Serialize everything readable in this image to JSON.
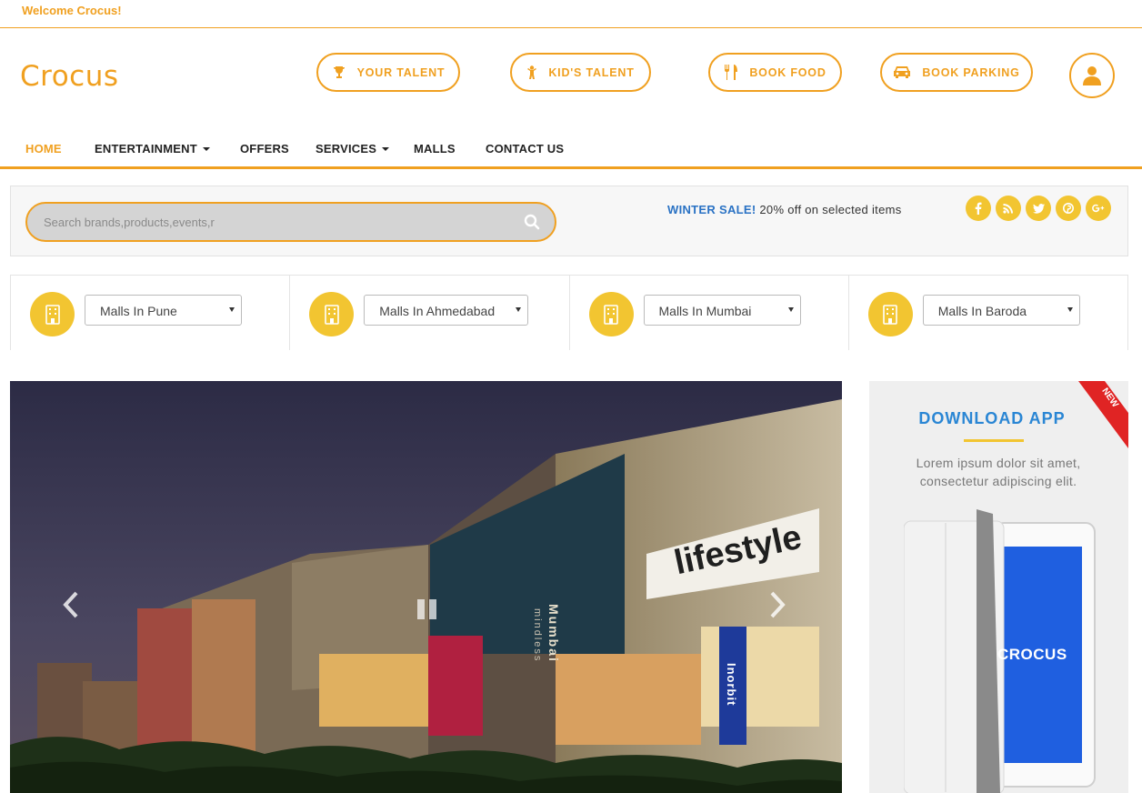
{
  "topbar": {
    "welcome": "Welcome Crocus!"
  },
  "brand": {
    "logo_text": "Crocus"
  },
  "header_buttons": [
    {
      "label": "YOUR TALENT",
      "icon": "trophy-icon"
    },
    {
      "label": "KID'S TALENT",
      "icon": "child-icon"
    },
    {
      "label": "BOOK FOOD",
      "icon": "cutlery-icon"
    },
    {
      "label": "BOOK PARKING",
      "icon": "car-icon"
    }
  ],
  "user": {
    "icon": "user-icon"
  },
  "nav": {
    "items": [
      {
        "label": "HOME",
        "active": true,
        "dropdown": false
      },
      {
        "label": "ENTERTAINMENT",
        "active": false,
        "dropdown": true
      },
      {
        "label": "OFFERS",
        "active": false,
        "dropdown": false
      },
      {
        "label": "SERVICES",
        "active": false,
        "dropdown": true
      },
      {
        "label": "MALLS",
        "active": false,
        "dropdown": false
      },
      {
        "label": "CONTACT US",
        "active": false,
        "dropdown": false
      }
    ]
  },
  "search": {
    "placeholder": "Search brands,products,events,r",
    "value": ""
  },
  "promo": {
    "highlight": "WINTER SALE!",
    "text": "20% off on selected items"
  },
  "socials": [
    "facebook-icon",
    "rss-icon",
    "twitter-icon",
    "pinterest-icon",
    "google-plus-icon"
  ],
  "malls": [
    {
      "selected": "Malls In Pune"
    },
    {
      "selected": "Malls In Ahmedabad"
    },
    {
      "selected": "Malls In Mumbai"
    },
    {
      "selected": "Malls In Baroda"
    }
  ],
  "hero": {
    "signs": {
      "store": "lifestyle",
      "vertical": "Mumbai",
      "tag": "mindless",
      "brand": "Inorbit"
    },
    "controls": [
      "prev-arrow-icon",
      "pause-icon",
      "next-arrow-icon"
    ]
  },
  "app_panel": {
    "ribbon": "NEW",
    "title": "DOWNLOAD APP",
    "description": "Lorem ipsum dolor sit amet, consectetur adipiscing elit.",
    "screen_text": "CROCUS"
  },
  "colors": {
    "accent": "#f0a020",
    "yellow": "#f2c531",
    "blue": "#2a86d4",
    "ribbon": "#e02424"
  }
}
